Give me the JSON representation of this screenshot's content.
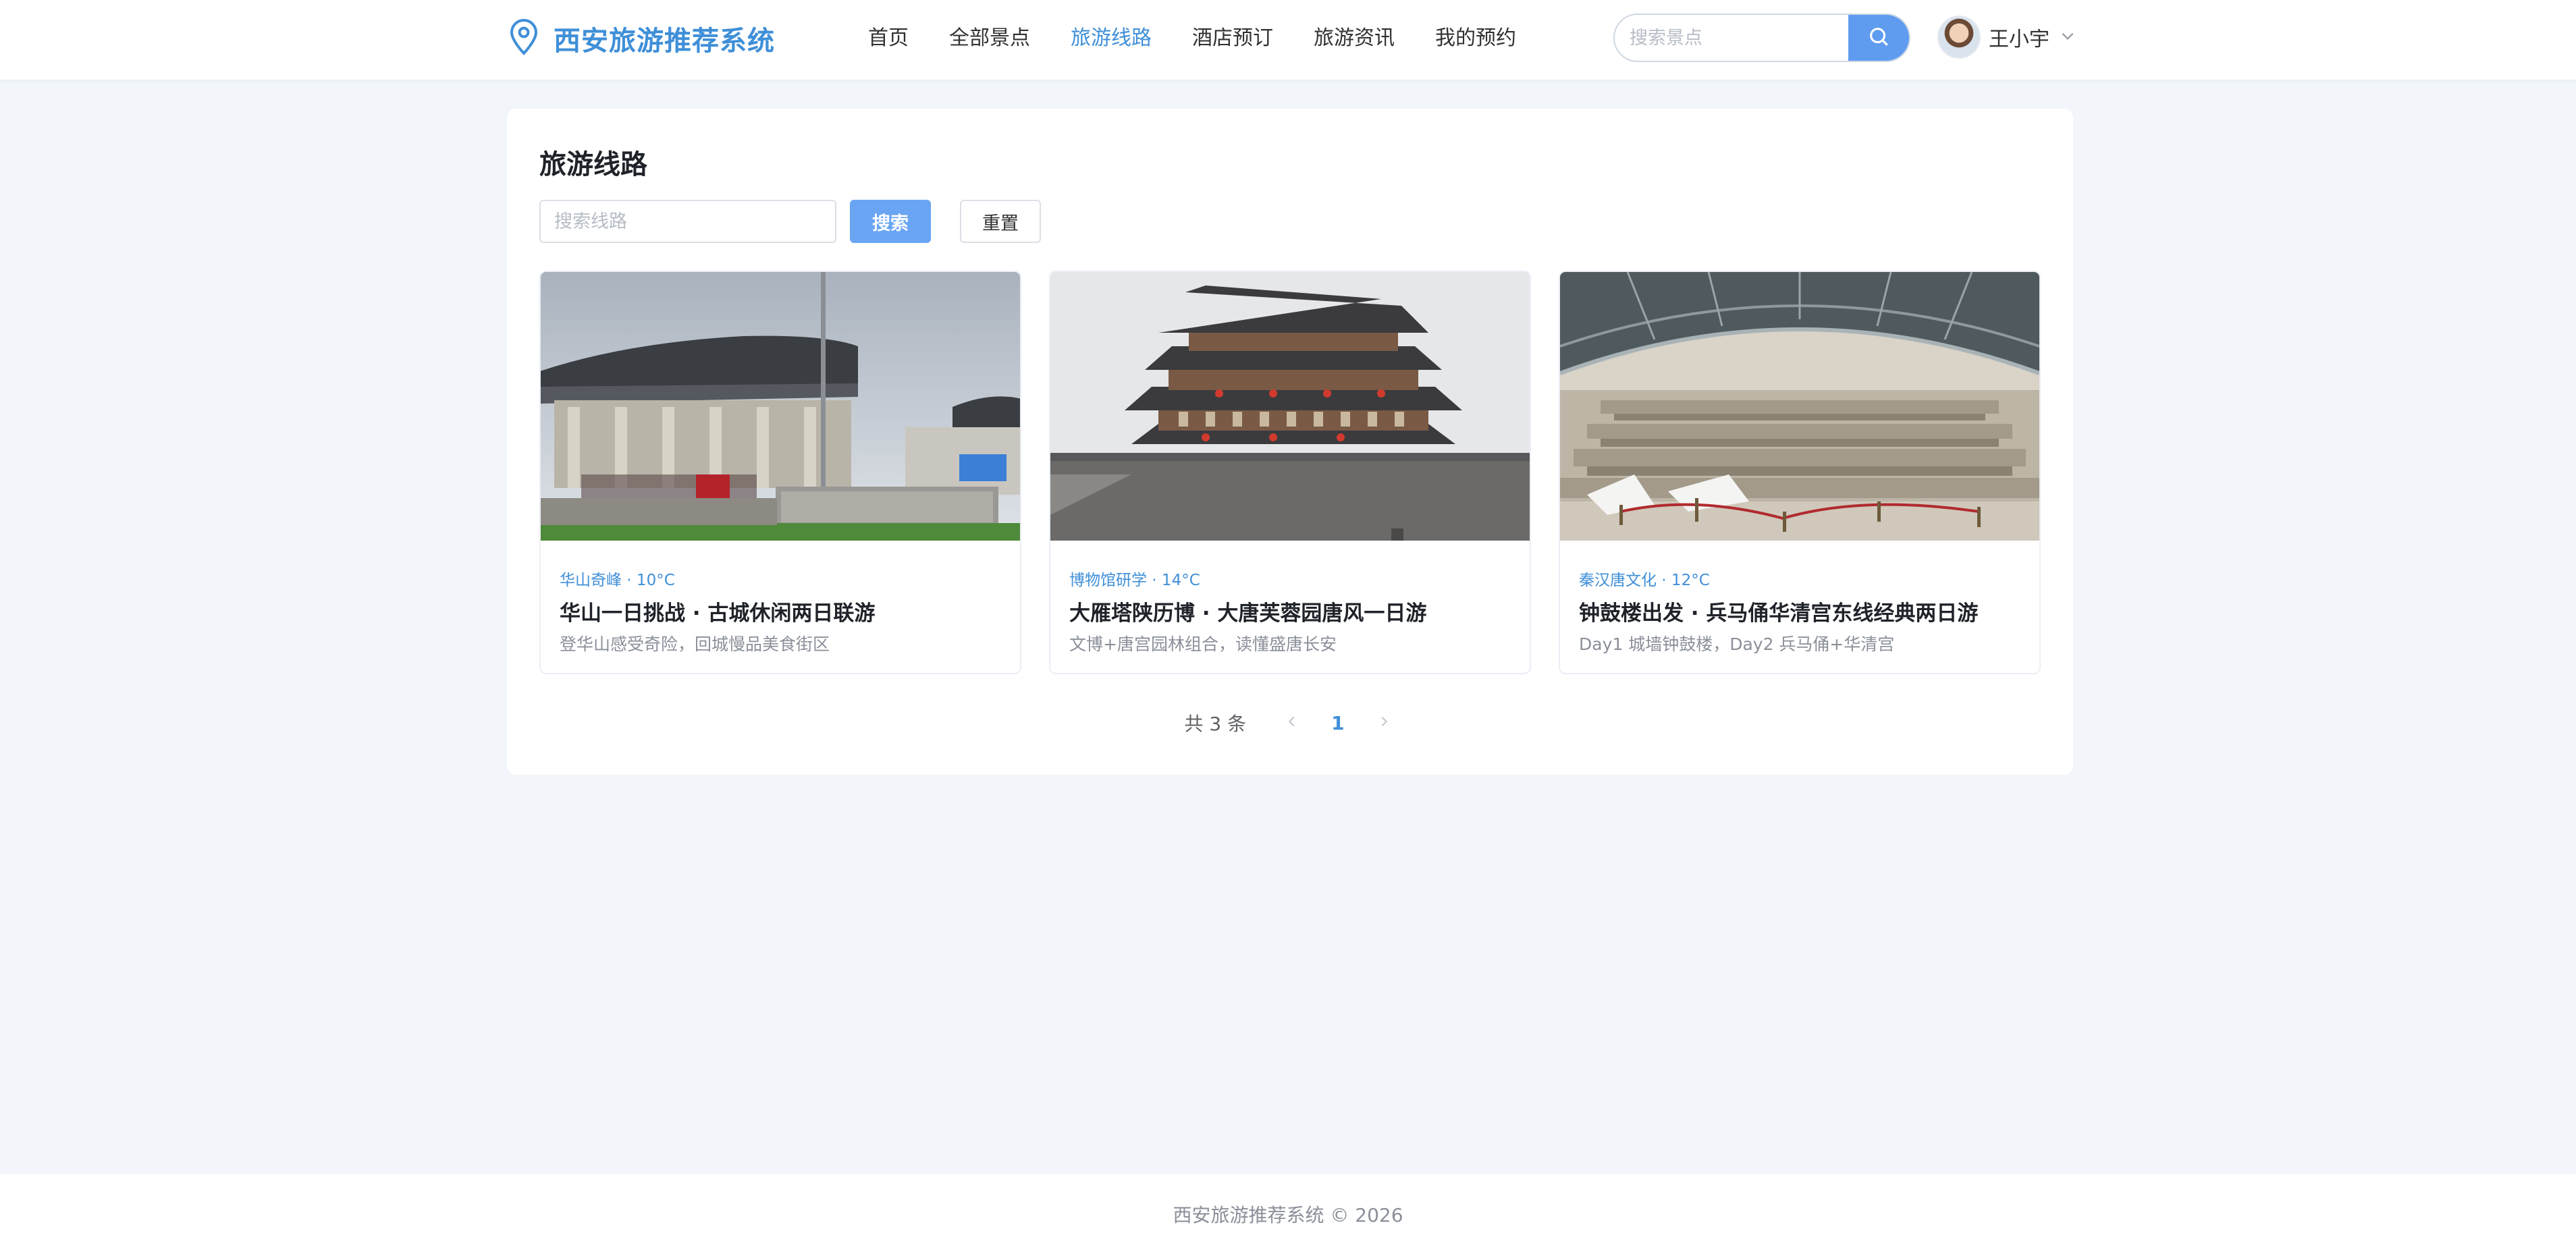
{
  "brand": {
    "name": "西安旅游推荐系统",
    "accent_color": "#3f8fd8"
  },
  "nav": {
    "items": [
      {
        "label": "首页"
      },
      {
        "label": "全部景点"
      },
      {
        "label": "旅游线路",
        "active": true
      },
      {
        "label": "酒店预订"
      },
      {
        "label": "旅游资讯"
      },
      {
        "label": "我的预约"
      }
    ]
  },
  "header_search": {
    "placeholder": "搜索景点",
    "value": "",
    "icon": "search-icon"
  },
  "user": {
    "name": "王小宇",
    "icon": "chevron-down-icon"
  },
  "page": {
    "title": "旅游线路",
    "search_placeholder": "搜索线路",
    "search_value": "",
    "search_button": "搜索",
    "reset_button": "重置"
  },
  "routes": [
    {
      "tag": "华山奇峰 · 10°C",
      "title": "华山一日挑战 · 古城休闲两日联游",
      "desc": "登华山感受奇险，回城慢品美食街区",
      "image": "museum-photo"
    },
    {
      "tag": "博物馆研学 · 14°C",
      "title": "大雁塔陕历博 · 大唐芙蓉园唐风一日游",
      "desc": "文博+唐宫园林组合，读懂盛唐长安",
      "image": "city-gate-tower-photo"
    },
    {
      "tag": "秦汉唐文化 · 12°C",
      "title": "钟鼓楼出发 · 兵马俑华清宫东线经典两日游",
      "desc": "Day1 城墙钟鼓楼，Day2 兵马俑+华清宫",
      "image": "terracotta-warriors-photo"
    }
  ],
  "pagination": {
    "total": "共 3 条",
    "current_page": "1"
  },
  "footer": {
    "text": "西安旅游推荐系统 © 2026"
  }
}
